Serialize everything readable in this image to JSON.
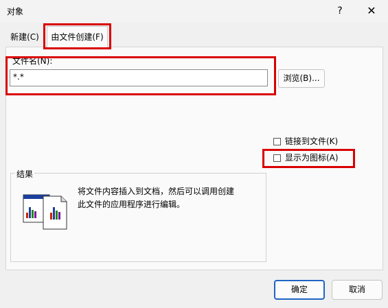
{
  "window": {
    "title": "对象",
    "help_glyph": "?",
    "close_glyph": "✕"
  },
  "tabs": [
    {
      "label": "新建(C)",
      "active": false
    },
    {
      "label": "由文件创建(F)",
      "active": true
    }
  ],
  "file": {
    "label": "文件名(N):",
    "value": "*.*",
    "browse_label": "浏览(B)..."
  },
  "options": {
    "link_label": "链接到文件(K)",
    "link_checked": false,
    "icon_label": "显示为图标(A)",
    "icon_checked": false
  },
  "result": {
    "label": "结果",
    "text": "将文件内容插入到文档，然后可以调用创建此文件的应用程序进行编辑。"
  },
  "footer": {
    "ok_label": "确定",
    "cancel_label": "取消"
  },
  "colors": {
    "highlight": "#d90000",
    "default_button_border": "#1f64c5"
  }
}
